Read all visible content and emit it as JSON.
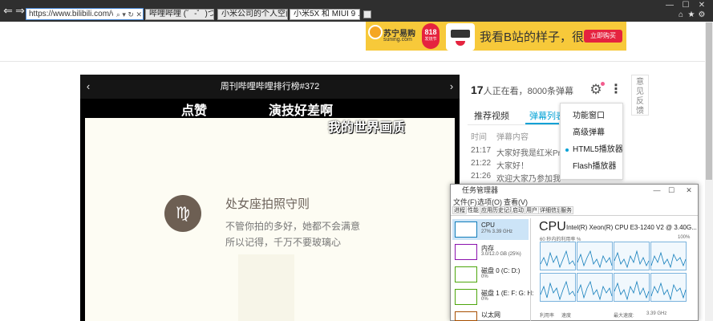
{
  "browser": {
    "url": "https://www.bilibili.com/vi",
    "tabs": [
      {
        "title": "哔哩哔哩 (゜-゜)つロ ..."
      },
      {
        "title": "小米公司的个人空间 -..."
      },
      {
        "title": "小米5X 和 MIUI 9 ..."
      }
    ]
  },
  "ad": {
    "brand": "苏宁易购",
    "domain": "suning.com",
    "badge": "818",
    "badge_sub": "发烧节",
    "slogan": "我看B站的样子，很囧",
    "button": "立即购买"
  },
  "player": {
    "title": "周刊哔哩哔哩排行榜#372"
  },
  "danmaku": [
    "点赞",
    "演技好差啊",
    "我的世界画质"
  ],
  "video_content": {
    "symbol": "♍",
    "title": "处女座拍照守则",
    "line1": "不管你拍的多好，她都不会满意",
    "line2": "所以记得，千万不要玻璃心"
  },
  "panel": {
    "viewer_count": "17",
    "viewer_text": "人正在看，8000条弹幕",
    "feedback": "意见反馈",
    "tabs": [
      "推荐视频",
      "弹幕列表"
    ],
    "headers": [
      "时间",
      "弹幕内容"
    ],
    "danmaku_list": [
      {
        "time": "21:17",
        "text": "大家好我是红米Pro 真"
      },
      {
        "time": "21:22",
        "text": "大家好！"
      },
      {
        "time": "21:26",
        "text": "欢迎大家乃参加我们"
      }
    ]
  },
  "dropdown": {
    "items": [
      "功能窗口",
      "高级弹幕",
      "HTML5播放器",
      "Flash播放器"
    ],
    "selected": "HTML5播放器"
  },
  "task_manager": {
    "title": "任务管理器",
    "menu": [
      "文件(F)",
      "选项(O)",
      "查看(V)"
    ],
    "tabs": [
      "进程",
      "性能",
      "应用历史记录",
      "启动",
      "用户",
      "详细信息",
      "服务"
    ],
    "active_tab": "性能",
    "items": [
      {
        "name": "CPU",
        "sub": "27%  3.39 GHz",
        "color": "#117dbb"
      },
      {
        "name": "内存",
        "sub": "3.0/12.0 GB (25%)",
        "color": "#8b12ae"
      },
      {
        "name": "磁盘 0 (C: D:)",
        "sub": "0%",
        "color": "#4da60c"
      },
      {
        "name": "磁盘 1 (E: F: G: H:",
        "sub": "0%",
        "color": "#4da60c"
      },
      {
        "name": "以太网",
        "sub": "",
        "color": "#a74f01"
      }
    ],
    "detail": {
      "heading": "CPU",
      "model": "Intel(R) Xeon(R) CPU E3-1240 V2 @ 3.40G...",
      "util_label": "60 秒内的利用率 %",
      "util_max": "100%",
      "stats": [
        "利用率",
        "速度",
        "最大速度:",
        "3.39 GHz"
      ]
    }
  }
}
